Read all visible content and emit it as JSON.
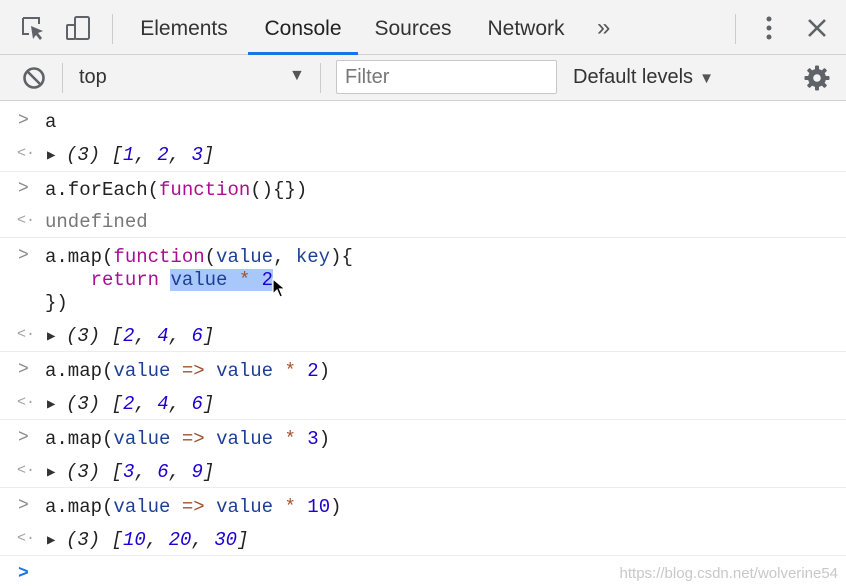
{
  "tabs": {
    "items": [
      "Elements",
      "Console",
      "Sources",
      "Network"
    ],
    "active": "Console",
    "overflow": "»"
  },
  "icons": {
    "inspect": "element-picker-icon",
    "device": "device-toolbar-icon",
    "menu": "kebab-menu-icon",
    "close": "close-icon",
    "clear": "clear-console-icon",
    "settings": "gear-icon"
  },
  "toolbar": {
    "context": "top",
    "context_arrow": "▼",
    "filter_placeholder": "Filter",
    "levels": "Default levels",
    "levels_arrow": "▼"
  },
  "console": {
    "prompt": ">",
    "return_marker": "<·",
    "expand": "▶",
    "entries": [
      {
        "input": "a",
        "output_count": "(3)",
        "output_values": [
          "1",
          "2",
          "3"
        ]
      },
      {
        "input": "a.forEach(function(){})",
        "output_text": "undefined"
      },
      {
        "input_lines": [
          "a.map(function(value, key){",
          "    return value * 2",
          "})"
        ],
        "selection": "value * 2",
        "output_count": "(3)",
        "output_values": [
          "2",
          "4",
          "6"
        ]
      },
      {
        "input": "a.map(value => value * 2)",
        "output_count": "(3)",
        "output_values": [
          "2",
          "4",
          "6"
        ]
      },
      {
        "input": "a.map(value => value * 3)",
        "output_count": "(3)",
        "output_values": [
          "3",
          "6",
          "9"
        ]
      },
      {
        "input": "a.map(value => value * 10)",
        "output_count": "(3)",
        "output_values": [
          "10",
          "20",
          "30"
        ]
      }
    ]
  },
  "watermark": "https://blog.csdn.net/wolverine54",
  "colors": {
    "accent": "#1a73e8",
    "keyword": "#aa0d91",
    "number": "#1c00cf",
    "variable": "#1c3f95",
    "operator": "#a0522d",
    "selection": "#a8c7fa"
  }
}
